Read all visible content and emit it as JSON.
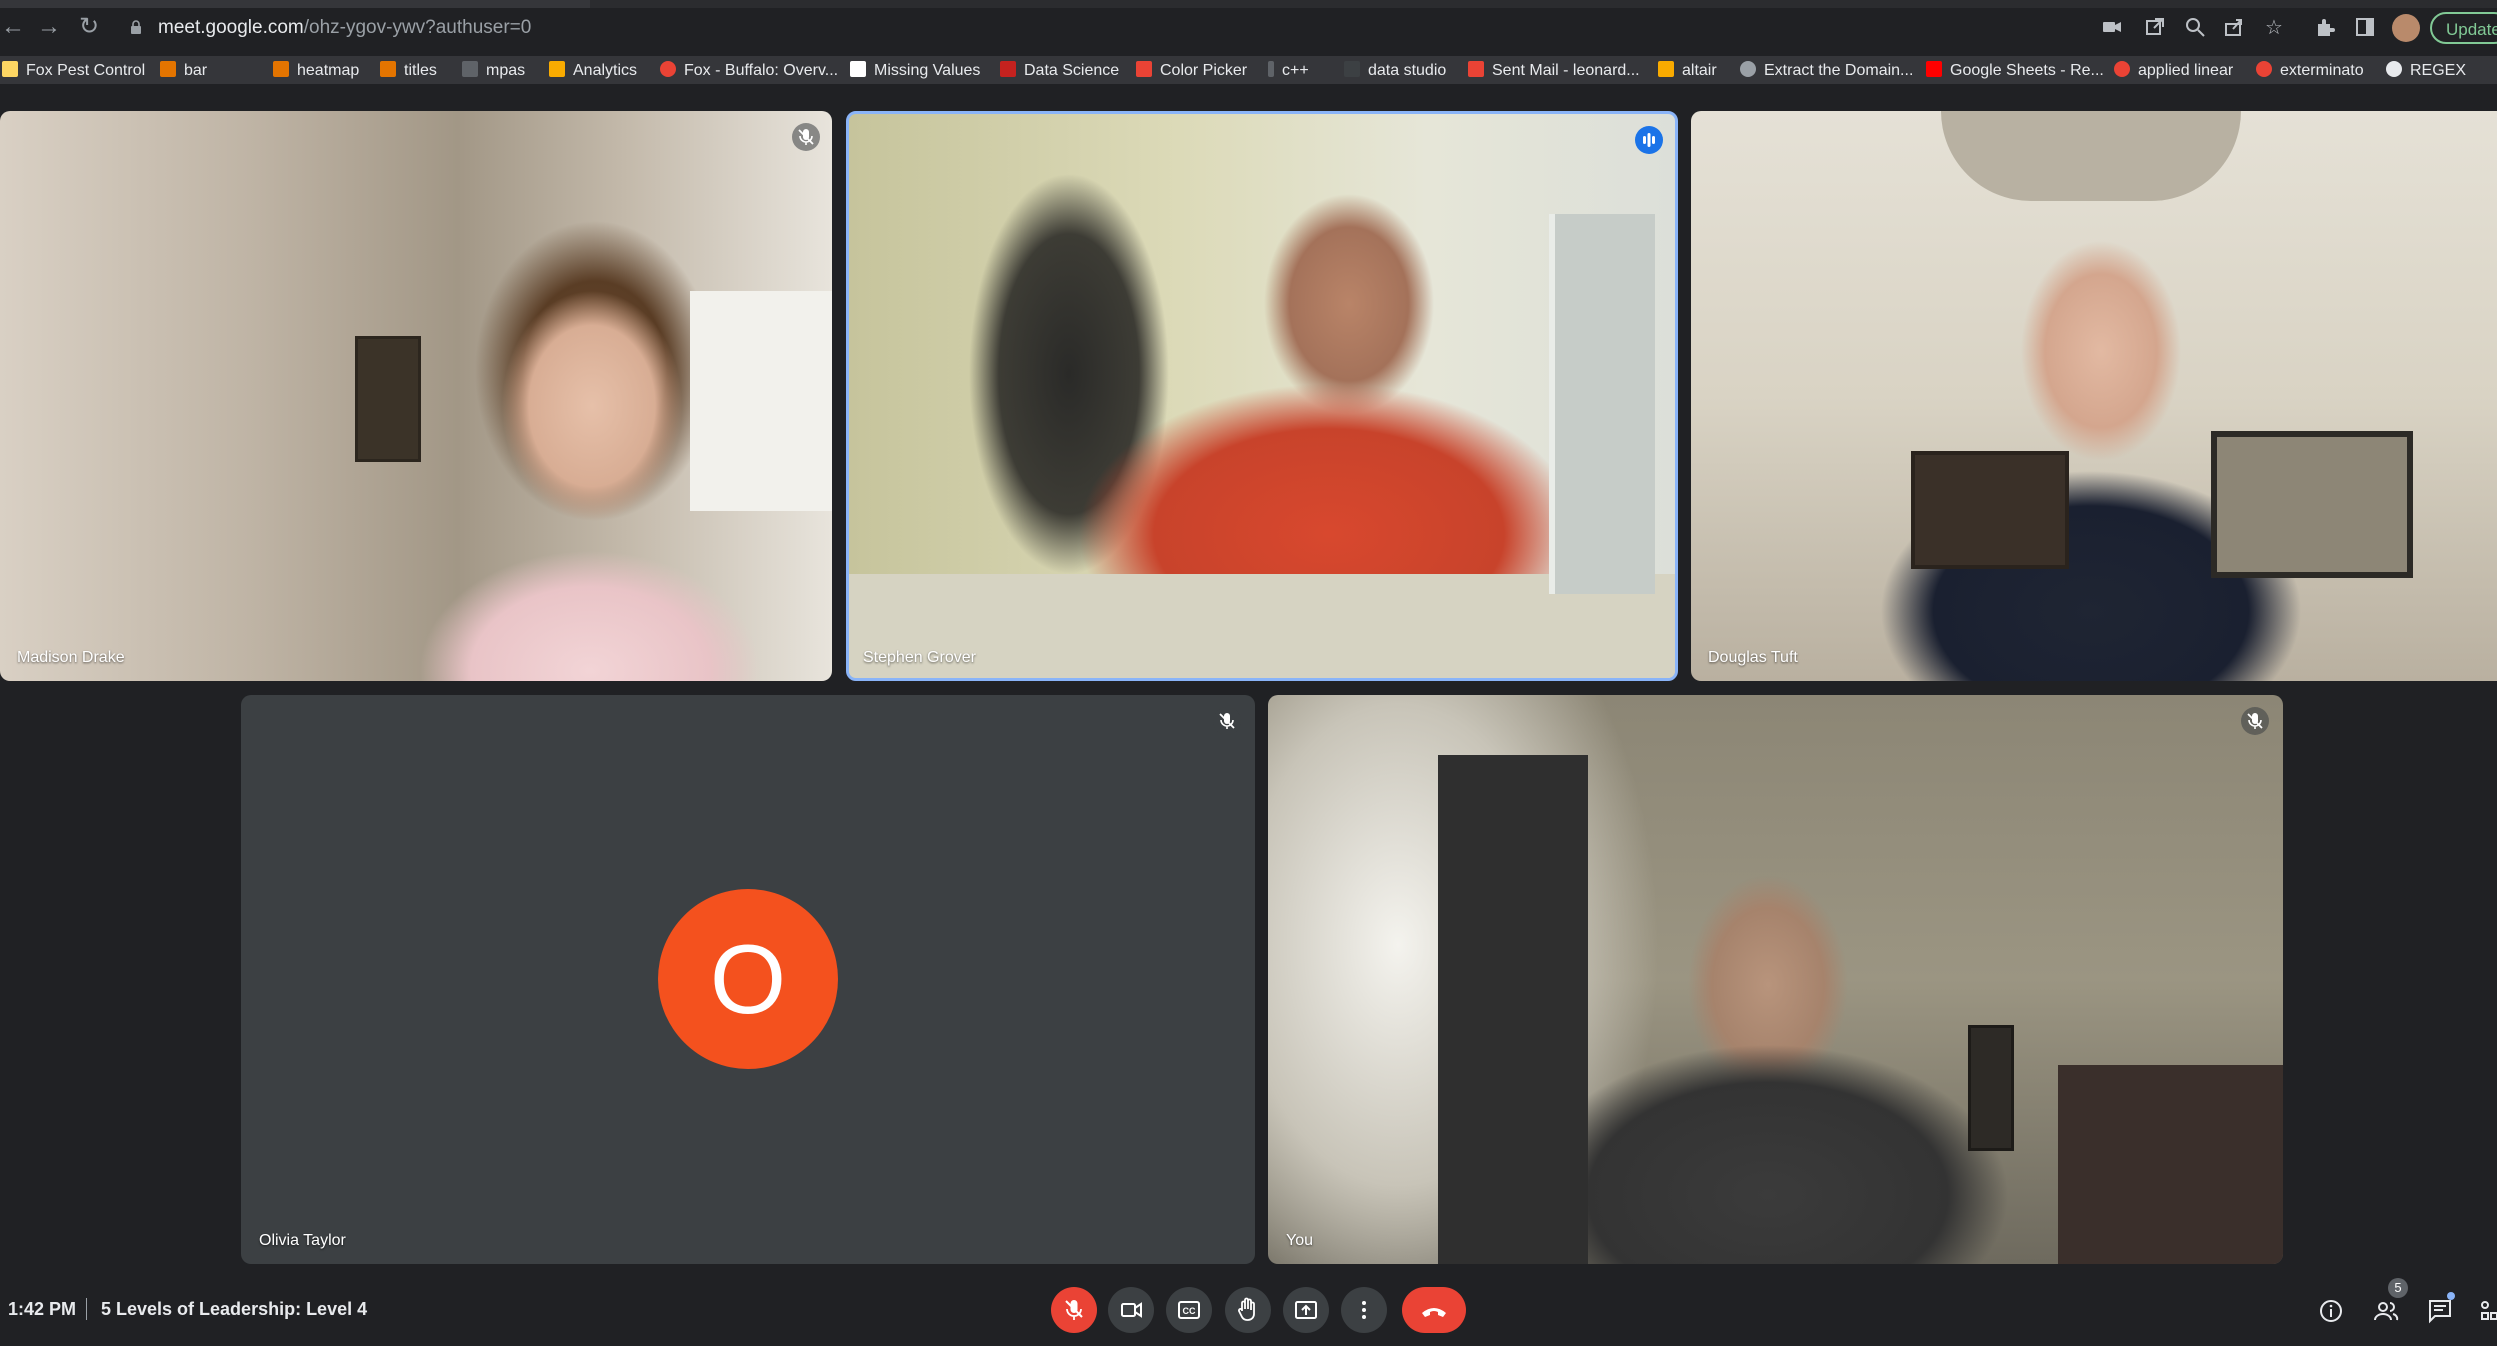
{
  "browser": {
    "url_host": "meet.google.com",
    "url_path": "/ohz-ygov-ywv?authuser=0",
    "update_label": "Update"
  },
  "bookmarks": [
    {
      "label": "Fox Pest Control",
      "icon": "folder-icon",
      "color": "#fdd663"
    },
    {
      "label": "bar",
      "icon": "chart-icon",
      "color": "#e37400"
    },
    {
      "label": "heatmap",
      "icon": "chart-icon",
      "color": "#e37400"
    },
    {
      "label": "titles",
      "icon": "chart-icon",
      "color": "#e37400"
    },
    {
      "label": "mpas",
      "icon": "map-icon",
      "color": "#5f6368"
    },
    {
      "label": "Analytics",
      "icon": "analytics-icon",
      "color": "#f9ab00"
    },
    {
      "label": "Fox - Buffalo: Overv...",
      "icon": "fox-icon",
      "color": "#ea4335"
    },
    {
      "label": "Missing Values",
      "icon": "alpha-icon",
      "color": "#ffffff"
    },
    {
      "label": "Data Science",
      "icon": "book-icon",
      "color": "#c5221f"
    },
    {
      "label": "Color Picker",
      "icon": "color-picker-icon",
      "color": "#ea4335"
    },
    {
      "label": "c++",
      "icon": "bar-icon",
      "color": "#5f6368"
    },
    {
      "label": "data studio",
      "icon": "studio-icon",
      "color": "#3c4043"
    },
    {
      "label": "Sent Mail - leonard...",
      "icon": "gmail-icon",
      "color": "#ea4335"
    },
    {
      "label": "altair",
      "icon": "altair-icon",
      "color": "#f9ab00"
    },
    {
      "label": "Extract the Domain...",
      "icon": "globe-icon",
      "color": "#9aa0a6"
    },
    {
      "label": "Google Sheets - Re...",
      "icon": "youtube-icon",
      "color": "#ff0000"
    },
    {
      "label": "applied linear",
      "icon": "gear-red-icon",
      "color": "#ea4335"
    },
    {
      "label": "exterminato",
      "icon": "fox-icon",
      "color": "#ea4335"
    },
    {
      "label": "REGEX",
      "icon": "regex-icon",
      "color": "#e8eaed"
    }
  ],
  "participants": [
    {
      "name": "Madison Drake",
      "muted": true
    },
    {
      "name": "Stephen Grover",
      "speaking": true
    },
    {
      "name": "Douglas Tuft",
      "muted": true
    },
    {
      "name": "Olivia Taylor",
      "muted": true,
      "initial": "O",
      "avatar_color": "#f4511e"
    },
    {
      "name": "You",
      "muted": true
    }
  ],
  "meeting": {
    "time": "1:42 PM",
    "title": "5 Levels of Leadership: Level 4",
    "people_count": "5"
  },
  "controls": [
    "mic-off-icon",
    "camera-icon",
    "captions-icon",
    "raise-hand-icon",
    "present-icon",
    "more-options-icon",
    "end-call-icon"
  ],
  "colors": {
    "accent": "#1a73e8",
    "danger": "#ea4335",
    "background": "#202124"
  }
}
